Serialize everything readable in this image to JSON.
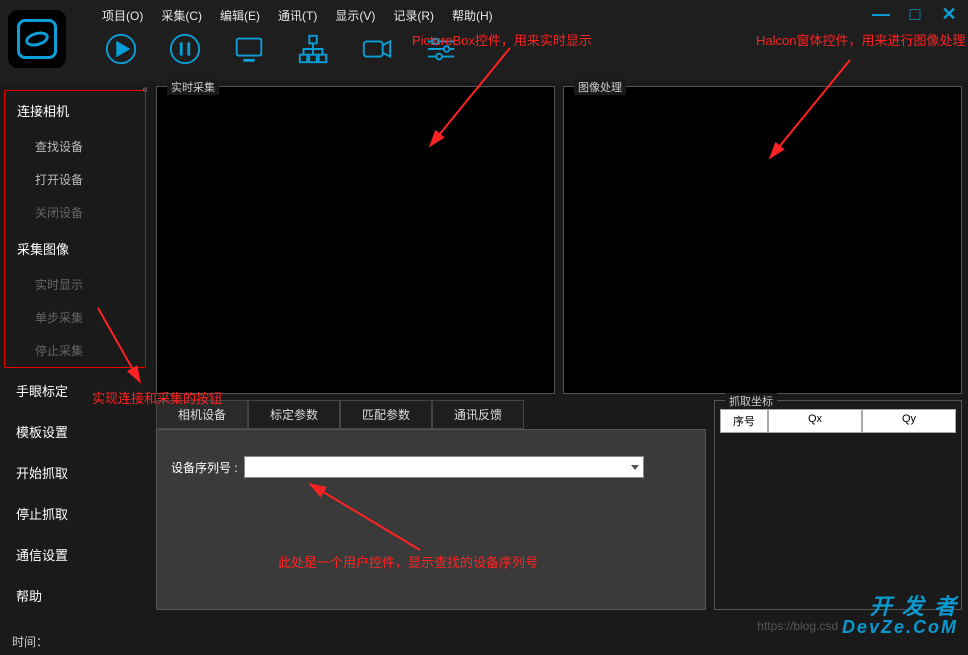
{
  "menu": {
    "project": "项目(O)",
    "capture": "采集(C)",
    "edit": "编辑(E)",
    "comm": "通讯(T)",
    "display": "显示(V)",
    "record": "记录(R)",
    "help": "帮助(H)"
  },
  "window_buttons": {
    "min": "—",
    "max": "□",
    "close": "✕"
  },
  "sidebar": {
    "group1": {
      "header": "连接相机",
      "items": [
        "查找设备",
        "打开设备",
        "关闭设备"
      ]
    },
    "group2": {
      "header": "采集图像",
      "items": [
        "实时显示",
        "单步采集",
        "停止采集"
      ]
    },
    "standalone": [
      "手眼标定",
      "模板设置",
      "开始抓取",
      "停止抓取",
      "通信设置",
      "帮助"
    ]
  },
  "panels": {
    "realtime": "实时采集",
    "process": "图像处理"
  },
  "tabs": {
    "items": [
      "相机设备",
      "标定参数",
      "匹配参数",
      "通讯反馈"
    ],
    "active_index": 0,
    "device_serial_label": "设备序列号 :",
    "device_serial_value": ""
  },
  "coord": {
    "title": "抓取坐标",
    "headers": [
      "序号",
      "Qx",
      "Qy"
    ]
  },
  "status": {
    "time_label": "时间："
  },
  "annotations": {
    "a1": "PictureBox控件，用来实时显示",
    "a2": "Halcon窗体控件，用来进行图像处理",
    "a3": "实现连接和采集的按钮",
    "a4": "此处是一个用户控件，显示查找的设备序列号"
  },
  "watermark": {
    "line1": "开 发 者",
    "line2": "DevZe.CoM",
    "url": "https://blog.csd"
  }
}
